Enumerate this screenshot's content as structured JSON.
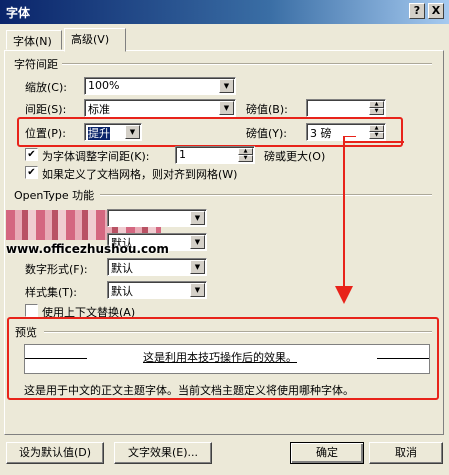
{
  "window": {
    "title": "字体",
    "help_label": "?",
    "close_label": "X"
  },
  "tabs": [
    {
      "label": "字体(N)"
    },
    {
      "label": "高级(V)"
    }
  ],
  "char_spacing": {
    "group_title": "字符间距",
    "scale": {
      "label": "缩放(C):",
      "value": "100%"
    },
    "spacing": {
      "label": "间距(S):",
      "value": "标准",
      "pt_label": "磅值(B):",
      "pt_value": ""
    },
    "position": {
      "label": "位置(P):",
      "value": "提升",
      "pt_label": "磅值(Y):",
      "pt_value": "3 磅"
    },
    "kerning": {
      "label": "为字体调整字间距(K):",
      "value": "1",
      "suffix": "磅或更大(O)",
      "checked": true
    },
    "snap_grid": {
      "label": "如果定义了文档网格，则对齐到网格(W)",
      "checked": true
    }
  },
  "opentype": {
    "group_title": "OpenType 功能",
    "ligatures_value": "",
    "spacing_value": "默认",
    "number_form": {
      "label": "数字形式(F):",
      "value": "默认"
    },
    "stylistic_set": {
      "label": "样式集(T):",
      "value": "默认"
    },
    "contextual": {
      "label": "使用上下文替换(A)",
      "checked": false
    }
  },
  "watermark": "www.officezhushou.com",
  "preview": {
    "group_title": "预览",
    "sample_text": "这是利用本技巧操作后的效果。",
    "note": "这是用于中文的正文主题字体。当前文档主题定义将使用哪种字体。"
  },
  "buttons": {
    "set_default": "设为默认值(D)",
    "text_effects": "文字效果(E)...",
    "ok": "确定",
    "cancel": "取消"
  },
  "colors": {
    "highlight": "#e8231a",
    "title_bar": "#0a246a"
  }
}
